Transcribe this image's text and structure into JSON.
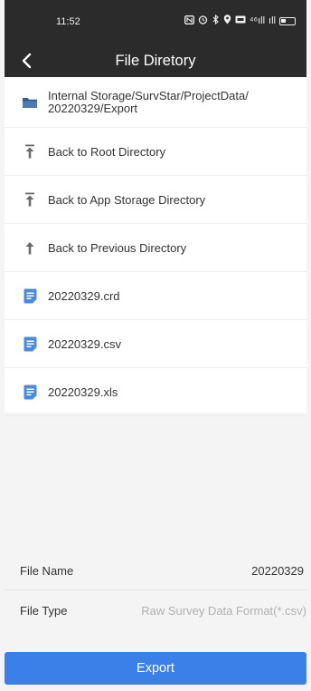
{
  "status_bar": {
    "time": "11:52",
    "icons": [
      "nfc-icon",
      "alarm-icon",
      "bluetooth-icon",
      "location-icon",
      "hd-icon",
      "signal-icon",
      "signal-icon",
      "battery-icon"
    ],
    "signal1": "⁴⁶ıll",
    "signal2": "ıll"
  },
  "header": {
    "title": "File Diretory"
  },
  "current_path": "Internal Storage/SurvStar/ProjectData/\n20220329/Export",
  "nav": {
    "root": "Back to Root Directory",
    "app_storage": "Back to App Storage Directory",
    "previous": "Back to Previous Directory"
  },
  "files": [
    {
      "name": "20220329.crd"
    },
    {
      "name": "20220329.csv"
    },
    {
      "name": "20220329.xls"
    }
  ],
  "form": {
    "file_name_label": "File Name",
    "file_name_value": "20220329",
    "file_type_label": "File Type",
    "file_type_placeholder": "Raw Survey Data Format(*.csv)"
  },
  "export_label": "Export",
  "colors": {
    "header_bg": "#2b2b2b",
    "accent": "#3b80e8",
    "icon_blue": "#4a8bdc",
    "icon_gray": "#6a6a6a"
  }
}
